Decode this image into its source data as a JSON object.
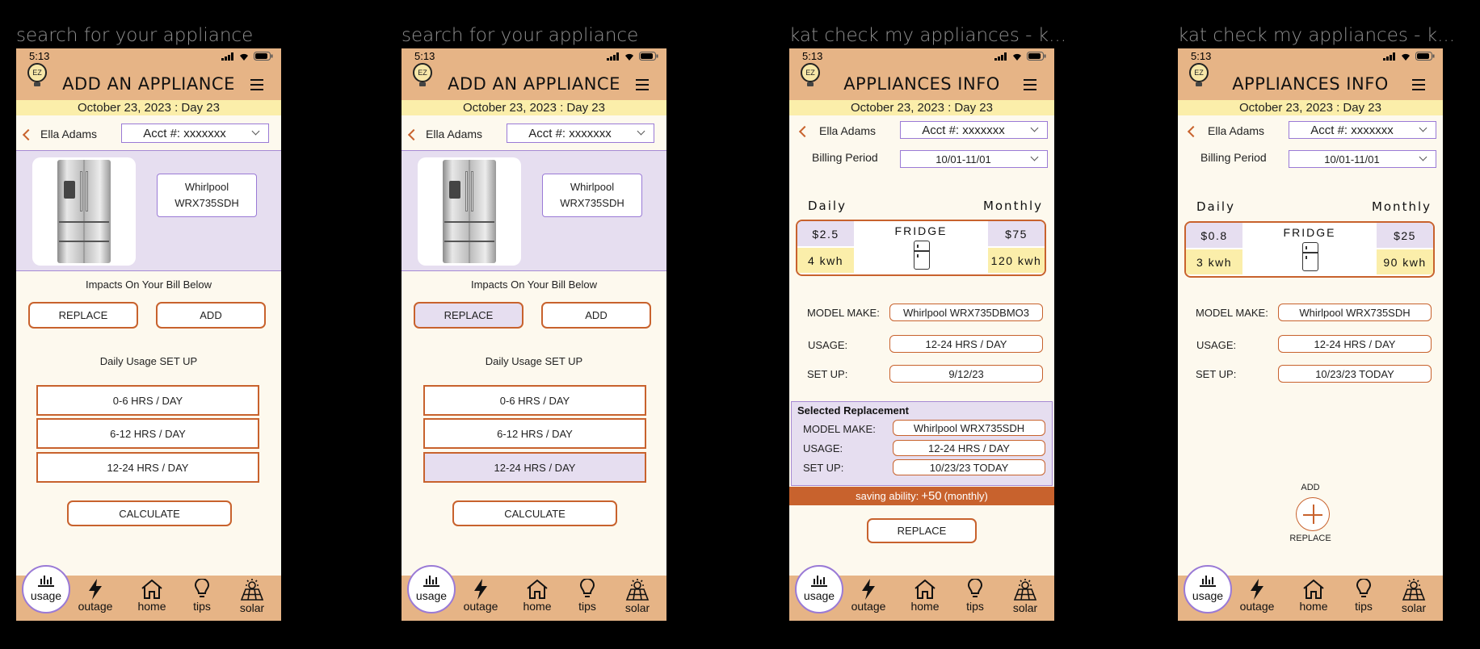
{
  "status_time": "5:13",
  "date_bar": "October 23, 2023 : Day 23",
  "logo_text": "EZ",
  "user_name": "Ella Adams",
  "account": "Acct #: xxxxxxx",
  "nav": {
    "usage": "usage",
    "outage": "outage",
    "home": "home",
    "tips": "tips",
    "solar": "solar"
  },
  "frames": [
    {
      "label": "search for your appliance",
      "title": "ADD AN APPLIANCE",
      "model": "Whirlpool WRX735SDH",
      "impacts": "Impacts On Your Bill Below",
      "replace": "REPLACE",
      "add": "ADD",
      "setup_title": "Daily Usage SET UP",
      "options": [
        "0-6 HRS / DAY",
        "6-12 HRS / DAY",
        "12-24 HRS / DAY"
      ],
      "calculate": "CALCULATE"
    },
    {
      "label": "search for your appliance",
      "title": "ADD AN APPLIANCE",
      "model": "Whirlpool WRX735SDH",
      "impacts": "Impacts On Your Bill Below",
      "replace": "REPLACE",
      "add": "ADD",
      "setup_title": "Daily Usage SET UP",
      "options": [
        "0-6 HRS / DAY",
        "6-12 HRS / DAY",
        "12-24 HRS / DAY"
      ],
      "calculate": "CALCULATE"
    },
    {
      "label": "kat check my appliances - k...",
      "title": "APPLIANCES INFO",
      "billing_label": "Billing Period",
      "billing_value": "10/01-11/01",
      "daily": "Daily",
      "monthly": "Monthly",
      "appliance": "FRIDGE",
      "daily_cost": "$2.5",
      "daily_kwh": "4 kwh",
      "monthly_cost": "$75",
      "monthly_kwh": "120 kwh",
      "model_label": "MODEL MAKE:",
      "model_value": "Whirlpool WRX735DBMO3",
      "usage_label": "USAGE:",
      "usage_value": "12-24 HRS / DAY",
      "setup_label": "SET UP:",
      "setup_value": "9/12/23",
      "replacement_title": "Selected Replacement",
      "repl_model": "Whirlpool WRX735SDH",
      "repl_usage": "12-24 HRS / DAY",
      "repl_setup": "10/23/23 TODAY",
      "saving_prefix": "saving ability:",
      "saving_value": "+50",
      "saving_suffix": "(monthly)",
      "replace": "REPLACE"
    },
    {
      "label": "kat check my appliances - k...",
      "title": "APPLIANCES INFO",
      "billing_label": "Billing Period",
      "billing_value": "10/01-11/01",
      "daily": "Daily",
      "monthly": "Monthly",
      "appliance": "FRIDGE",
      "daily_cost": "$0.8",
      "daily_kwh": "3 kwh",
      "monthly_cost": "$25",
      "monthly_kwh": "90 kwh",
      "model_label": "MODEL MAKE:",
      "model_value": "Whirlpool WRX735SDH",
      "usage_label": "USAGE:",
      "usage_value": "12-24 HRS / DAY",
      "setup_label": "SET UP:",
      "setup_value": "10/23/23 TODAY",
      "add": "ADD",
      "replace": "REPLACE"
    }
  ],
  "colors": {
    "header": "#e6b486",
    "accent": "#c8622d",
    "lavender": "#e6def0",
    "date_bar": "#fbeeaa",
    "background": "#fdf9ee"
  }
}
